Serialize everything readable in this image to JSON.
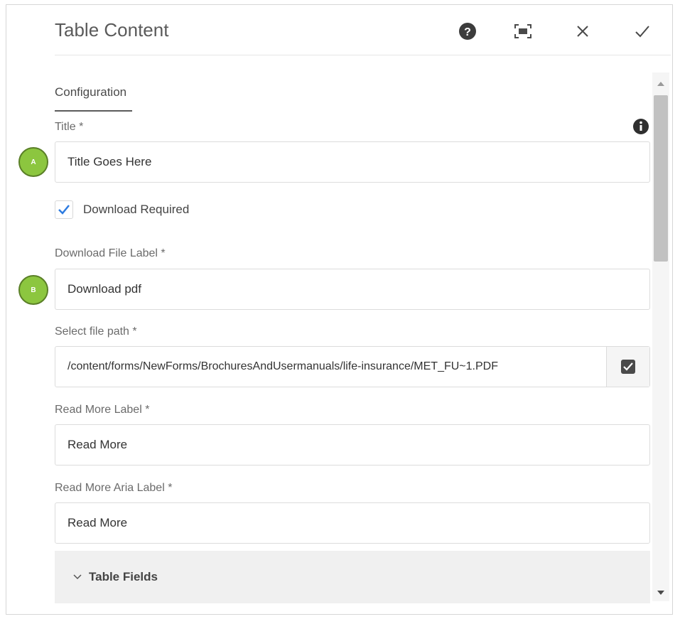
{
  "dialog": {
    "title": "Table Content",
    "header_icons": [
      "help-icon",
      "fullscreen-icon",
      "close-icon",
      "check-icon"
    ]
  },
  "tabs": [
    {
      "label": "Configuration",
      "active": true
    }
  ],
  "form": {
    "title": {
      "label": "Title *",
      "value": "Title Goes Here",
      "badge": "A"
    },
    "download_required": {
      "label": "Download Required",
      "checked": true
    },
    "download_file_label": {
      "label": "Download File Label *",
      "value": "Download pdf",
      "badge": "B"
    },
    "file_path": {
      "label": "Select file path *",
      "value": "/content/forms/NewForms/BrochuresAndUsermanuals/life-insurance/MET_FU~1.PDF"
    },
    "read_more_label": {
      "label": "Read More Label *",
      "value": "Read More"
    },
    "read_more_aria_label": {
      "label": "Read More Aria Label *",
      "value": "Read More"
    }
  },
  "accordion": {
    "label": "Table Fields",
    "expanded": false
  },
  "colors": {
    "accent_check": "#2d7be0",
    "badge_fill": "#8cc63f"
  }
}
